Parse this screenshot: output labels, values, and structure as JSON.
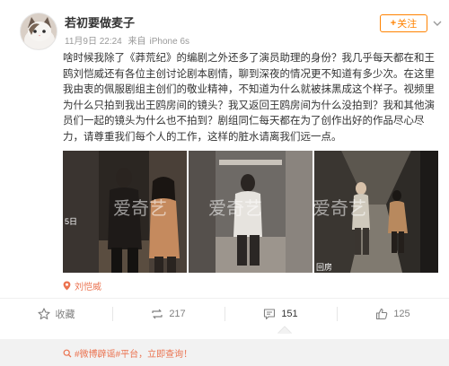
{
  "post": {
    "username": "若初要做麦子",
    "date": "11月9日 22:24",
    "source_prefix": "来自",
    "source": "iPhone 6s",
    "follow_label": "关注",
    "text": "啥时候我除了《莽荒纪》的编剧之外还多了演员助理的身份？我几乎每天都在和王鸥刘恺威还有各位主创讨论剧本剧情，聊到深夜的情况更不知道有多少次。在这里我由衷的佩服剧组主创们的敬业精神，不知道为什么就被抹黑成这个样子。视频里为什么只拍到我出王鸥房间的镜头？我又返回王鸥房间为什么没拍到？我和其他演员们一起的镜头为什么也不拍到？剧组同仁每天都在为了创作出好的作品尽心尽力，请尊重我们每个人的工作，这样的脏水请离我们远一点。",
    "location": "刘恺威"
  },
  "photos": {
    "watermark": "爱奇艺",
    "caption_1": "5日",
    "caption_3": "回房"
  },
  "actions": {
    "favorite": "收藏",
    "repost": "217",
    "comment": "151",
    "like": "125"
  },
  "notice": {
    "tag": "#微博辟谣#",
    "text": "平台，立即查询！"
  },
  "colors": {
    "accent": "#ff8200",
    "link": "#eb7350",
    "muted": "#808080"
  },
  "icons": [
    "avatar-cat",
    "chevron-down-icon",
    "location-pin-icon",
    "star-icon",
    "repost-icon",
    "comment-icon",
    "thumbs-up-icon",
    "search-icon"
  ]
}
